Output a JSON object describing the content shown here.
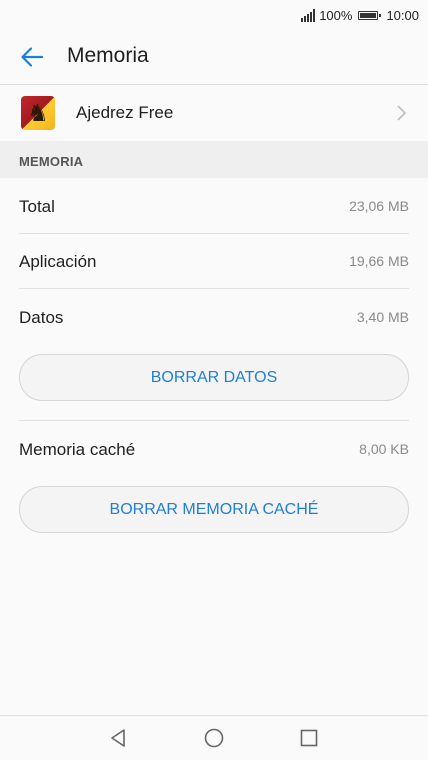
{
  "status_bar": {
    "battery_percent": "100%",
    "time": "10:00"
  },
  "header": {
    "title": "Memoria"
  },
  "app": {
    "name": "Ajedrez Free",
    "icon": "chess-knight-icon"
  },
  "section": {
    "title": "MEMORIA"
  },
  "storage": {
    "rows": [
      {
        "label": "Total",
        "value": "23,06 MB"
      },
      {
        "label": "Aplicación",
        "value": "19,66 MB"
      },
      {
        "label": "Datos",
        "value": "3,40 MB"
      }
    ],
    "clear_data_label": "BORRAR DATOS",
    "cache": {
      "label": "Memoria caché",
      "value": "8,00 KB"
    },
    "clear_cache_label": "BORRAR MEMORIA CACHÉ"
  },
  "colors": {
    "accent": "#1e7ed8",
    "secondary_text": "#8a8a8a",
    "section_bg": "#efefef"
  }
}
